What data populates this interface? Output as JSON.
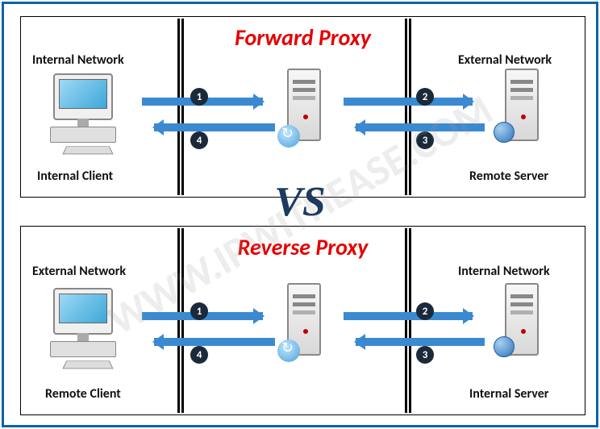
{
  "watermark": "WWW.IPWITHEASE.COM",
  "vs": "VS",
  "top": {
    "title": "Forward Proxy",
    "left_network_label": "Internal Network",
    "left_node_label": "Internal Client",
    "right_network_label": "External Network",
    "right_node_label": "Remote Server",
    "steps": {
      "s1": "1",
      "s2": "2",
      "s3": "3",
      "s4": "4"
    }
  },
  "bottom": {
    "title": "Reverse Proxy",
    "left_network_label": "External Network",
    "left_node_label": "Remote Client",
    "right_network_label": "Internal Network",
    "right_node_label": "Internal Server",
    "steps": {
      "s1": "1",
      "s2": "2",
      "s3": "3",
      "s4": "4"
    }
  }
}
